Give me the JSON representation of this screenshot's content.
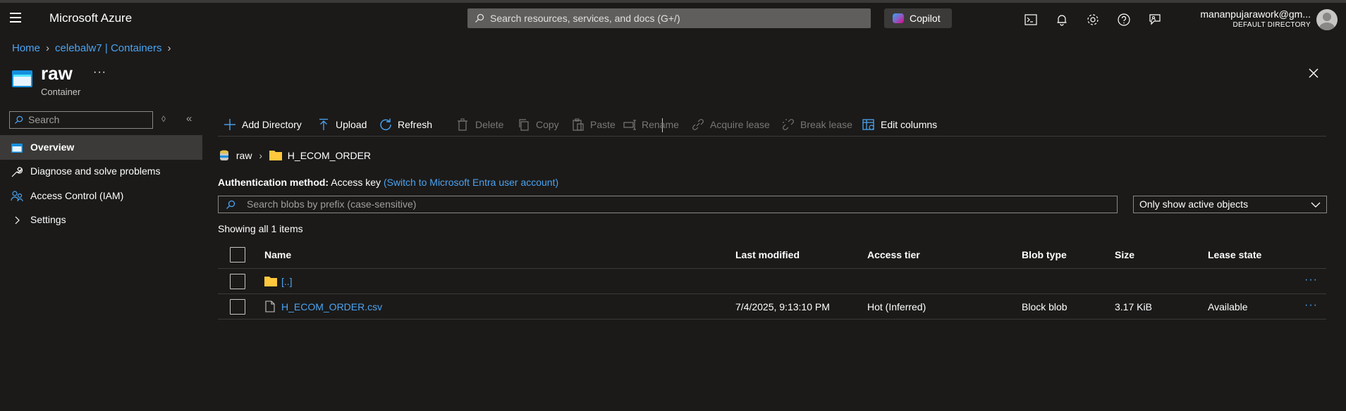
{
  "topbar": {
    "brand": "Microsoft Azure",
    "search_placeholder": "Search resources, services, and docs (G+/)",
    "copilot": "Copilot",
    "user_email": "mananpujarawork@gm...",
    "user_directory": "DEFAULT DIRECTORY",
    "icons": [
      "menu-icon",
      "cloud-shell-icon",
      "bell-icon",
      "gear-icon",
      "help-icon",
      "feedback-icon"
    ]
  },
  "breadcrumb": {
    "items": [
      "Home",
      "celebalw7 | Containers"
    ]
  },
  "page": {
    "title": "raw",
    "more": "···",
    "subtitle": "Container"
  },
  "sidebar": {
    "search_placeholder": "Search",
    "items": [
      {
        "label": "Overview",
        "icon": "container-icon",
        "active": true
      },
      {
        "label": "Diagnose and solve problems",
        "icon": "wrench-icon"
      },
      {
        "label": "Access Control (IAM)",
        "icon": "people-icon"
      },
      {
        "label": "Settings",
        "icon": "chevron-right-icon"
      }
    ]
  },
  "toolbar": {
    "add_directory": "Add Directory",
    "upload": "Upload",
    "refresh": "Refresh",
    "delete": "Delete",
    "copy": "Copy",
    "paste": "Paste",
    "rename": "Rename",
    "acquire_lease": "Acquire lease",
    "break_lease": "Break lease",
    "edit_columns": "Edit columns"
  },
  "path": {
    "root": "raw",
    "folder": "H_ECOM_ORDER"
  },
  "auth": {
    "label": "Authentication method:",
    "value": "Access key",
    "switch_link": "(Switch to Microsoft Entra user account)"
  },
  "blob_search": {
    "placeholder": "Search blobs by prefix (case-sensitive)"
  },
  "filter": {
    "selected": "Only show active objects"
  },
  "count_text": "Showing all 1 items",
  "grid": {
    "columns": [
      "Name",
      "Last modified",
      "Access tier",
      "Blob type",
      "Size",
      "Lease state"
    ],
    "rows": [
      {
        "name": "[..]",
        "type": "folder",
        "last_modified": "",
        "access_tier": "",
        "blob_type": "",
        "size": "",
        "lease_state": "",
        "more": "···"
      },
      {
        "name": "H_ECOM_ORDER.csv",
        "type": "file",
        "last_modified": "7/4/2025, 9:13:10 PM",
        "access_tier": "Hot (Inferred)",
        "blob_type": "Block blob",
        "size": "3.17 KiB",
        "lease_state": "Available",
        "more": "···"
      }
    ]
  },
  "colors": {
    "background": "#1b1a19",
    "link": "#4ba3f1",
    "search_bg": "#605e5c",
    "active_nav": "#3b3a39"
  }
}
